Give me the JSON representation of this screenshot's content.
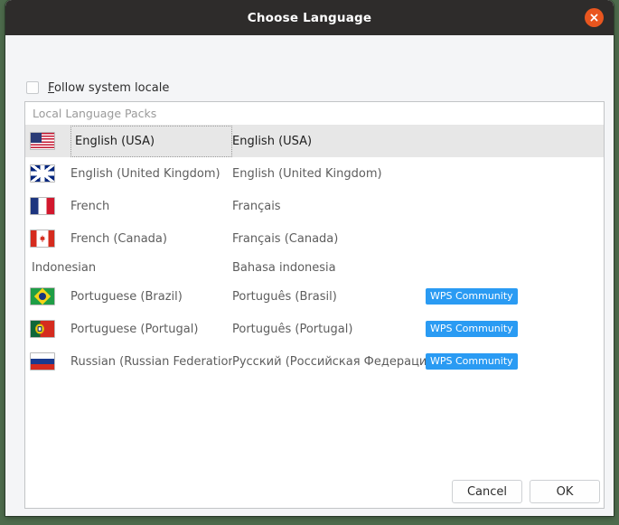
{
  "window": {
    "title": "Choose Language",
    "close_icon": "close-icon",
    "accent_close": "#e9561f",
    "titlebar_bg": "#2e2c2b",
    "body_bg": "#f4f5f7",
    "desktop_bg": "#4d6b4c"
  },
  "options": {
    "follow_system_locale": {
      "label_mnemonic": "F",
      "label_rest": "ollow system locale",
      "label_full": "Follow system locale",
      "checked": false
    }
  },
  "group": {
    "caption": "Local Language Packs"
  },
  "list": {
    "selected_index": 0,
    "badge_color": "#2a9bf3",
    "rows": [
      {
        "flag": "flag-usa-icon",
        "flag_class": "usa",
        "name": "English (USA)",
        "native": "English (USA)",
        "badge": "",
        "selected": true
      },
      {
        "flag": "flag-uk-icon",
        "flag_class": "uk",
        "name": "English (United Kingdom)",
        "native": "English (United Kingdom)",
        "badge": "",
        "selected": false
      },
      {
        "flag": "flag-france-icon",
        "flag_class": "fr",
        "name": "French",
        "native": "Français",
        "badge": "",
        "selected": false
      },
      {
        "flag": "flag-canada-icon",
        "flag_class": "ca",
        "name": "French (Canada)",
        "native": "Français (Canada)",
        "badge": "",
        "selected": false
      },
      {
        "flag": "",
        "flag_class": "",
        "name": "Indonesian",
        "native": "Bahasa indonesia",
        "badge": "",
        "selected": false
      },
      {
        "flag": "flag-brazil-icon",
        "flag_class": "br",
        "name": "Portuguese (Brazil)",
        "native": "Português (Brasil)",
        "badge": "WPS Community",
        "selected": false
      },
      {
        "flag": "flag-portugal-icon",
        "flag_class": "pt",
        "name": "Portuguese (Portugal)",
        "native": "Português (Portugal)",
        "badge": "WPS Community",
        "selected": false
      },
      {
        "flag": "flag-russia-icon",
        "flag_class": "ru",
        "name": "Russian (Russian Federation)",
        "native": "Русский (Российская Федерация)",
        "badge": "WPS Community",
        "selected": false
      }
    ]
  },
  "footer": {
    "cancel_label": "Cancel",
    "ok_label": "OK"
  }
}
